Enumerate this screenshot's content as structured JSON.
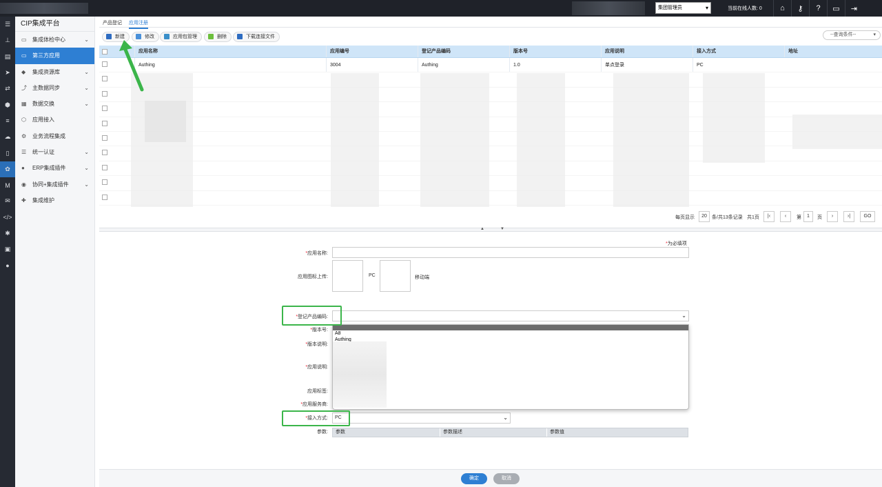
{
  "topbar": {
    "role_select": "集团管理员",
    "online_label": "当前在线人数: 0",
    "icons": [
      "home-icon",
      "key-icon",
      "help-icon",
      "monitor-icon",
      "logout-icon"
    ]
  },
  "rail": {
    "icons": [
      "menu-icon",
      "org-icon",
      "dashboard-icon",
      "send-icon",
      "exchange-icon",
      "cube-icon",
      "layers-icon",
      "cloud-icon",
      "document-icon",
      "apps-icon",
      "m-icon",
      "chat-icon",
      "code-icon",
      "gear-icon",
      "desktop-icon",
      "user-icon"
    ]
  },
  "sidenav": {
    "brand": "CIP集成平台",
    "items": [
      {
        "label": "集成体检中心",
        "chevron": true
      },
      {
        "label": "第三方应用",
        "chevron": false,
        "active": true
      },
      {
        "label": "集成资源库",
        "chevron": true
      },
      {
        "label": "主数据同步",
        "chevron": true
      },
      {
        "label": "数据交换",
        "chevron": true
      },
      {
        "label": "应用接入",
        "chevron": false
      },
      {
        "label": "业务流程集成",
        "chevron": false
      },
      {
        "label": "统一认证",
        "chevron": true
      },
      {
        "label": "ERP集成插件",
        "chevron": true
      },
      {
        "label": "协同+集成插件",
        "chevron": true
      },
      {
        "label": "集成维护",
        "chevron": false
      }
    ]
  },
  "tabs": {
    "t1": "产品登记",
    "t2": "应用注册"
  },
  "toolbar": {
    "new": "新建",
    "edit": "修改",
    "pkg": "应用包管理",
    "del": "删除",
    "download": "下载连接文件",
    "query": "--查询条件--"
  },
  "grid": {
    "headers": [
      "应用名称",
      "应用编号",
      "登记产品编码",
      "版本号",
      "应用说明",
      "接入方式",
      "地址"
    ],
    "rows": [
      [
        "Authing",
        "3004",
        "Authing",
        "1.0",
        "单点登录",
        "PC",
        ""
      ]
    ]
  },
  "pager": {
    "per_page_label": "每页显示",
    "per_page": "20",
    "total": "条/共13条记录",
    "pages": "共1页",
    "page_prefix": "第",
    "page": "1",
    "page_suffix": "页",
    "go": "GO"
  },
  "form": {
    "required_note": "为必填项",
    "app_name": "应用名称:",
    "icon_upload": "应用图标上传:",
    "pc": "PC",
    "mobile": "移动端",
    "product_code": "登记产品编码:",
    "version": "版本号:",
    "version_desc": "版本说明:",
    "app_desc": "应用说明:",
    "app_tag": "应用标签:",
    "provider": "应用服务商:",
    "access": "接入方式:",
    "access_value": "PC",
    "params": "参数:",
    "param_headers": [
      "参数",
      "参数描述",
      "参数值"
    ],
    "dropdown_options": [
      "A8",
      "Authing"
    ]
  },
  "footer": {
    "ok": "确定",
    "cancel": "取消"
  },
  "colors": {
    "accent": "#2e7fd3",
    "highlight": "#3bb54a"
  }
}
